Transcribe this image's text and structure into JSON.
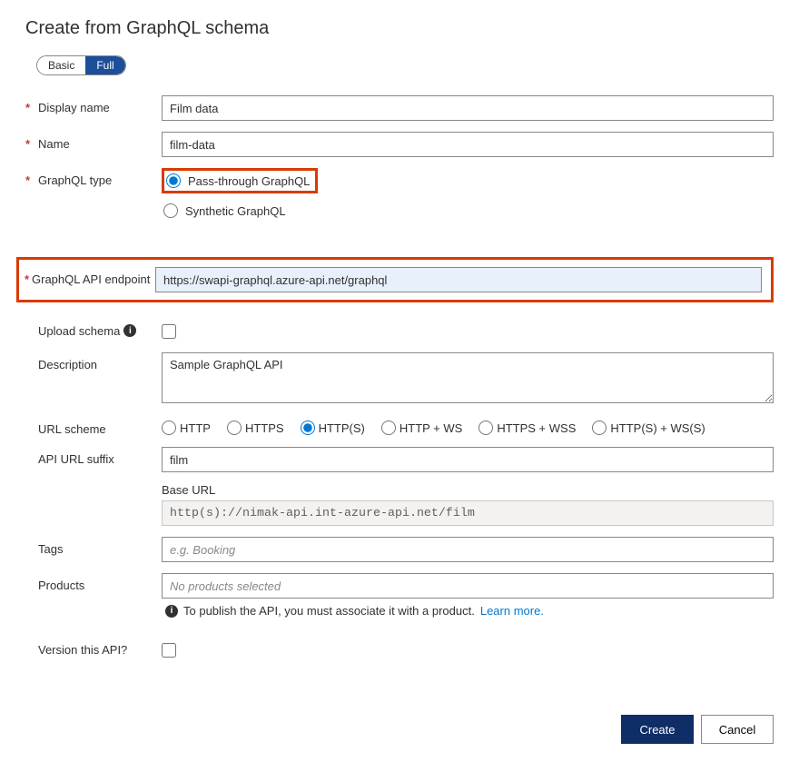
{
  "title": "Create from GraphQL schema",
  "toggle": {
    "basic": "Basic",
    "full": "Full"
  },
  "labels": {
    "displayName": "Display name",
    "name": "Name",
    "graphqlType": "GraphQL type",
    "endpoint": "GraphQL API endpoint",
    "uploadSchema": "Upload schema",
    "description": "Description",
    "urlScheme": "URL scheme",
    "apiUrlSuffix": "API URL suffix",
    "baseUrl": "Base URL",
    "tags": "Tags",
    "products": "Products",
    "versionThisApi": "Version this API?"
  },
  "values": {
    "displayName": "Film data",
    "name": "film-data",
    "endpoint": "https://swapi-graphql.azure-api.net/graphql",
    "description": "Sample GraphQL API",
    "apiUrlSuffix": "film",
    "baseUrl": "http(s)://nimak-api.int-azure-api.net/film"
  },
  "graphqlTypeOptions": {
    "passthrough": "Pass-through GraphQL",
    "synthetic": "Synthetic GraphQL"
  },
  "urlSchemeOptions": {
    "http": "HTTP",
    "https": "HTTPS",
    "httpS": "HTTP(S)",
    "httpWs": "HTTP + WS",
    "httpsWss": "HTTPS + WSS",
    "httpSWsS": "HTTP(S) + WS(S)"
  },
  "placeholders": {
    "tags": "e.g. Booking",
    "products": "No products selected"
  },
  "info": {
    "publishNote": "To publish the API, you must associate it with a product.",
    "learnMore": "Learn more"
  },
  "buttons": {
    "create": "Create",
    "cancel": "Cancel"
  }
}
